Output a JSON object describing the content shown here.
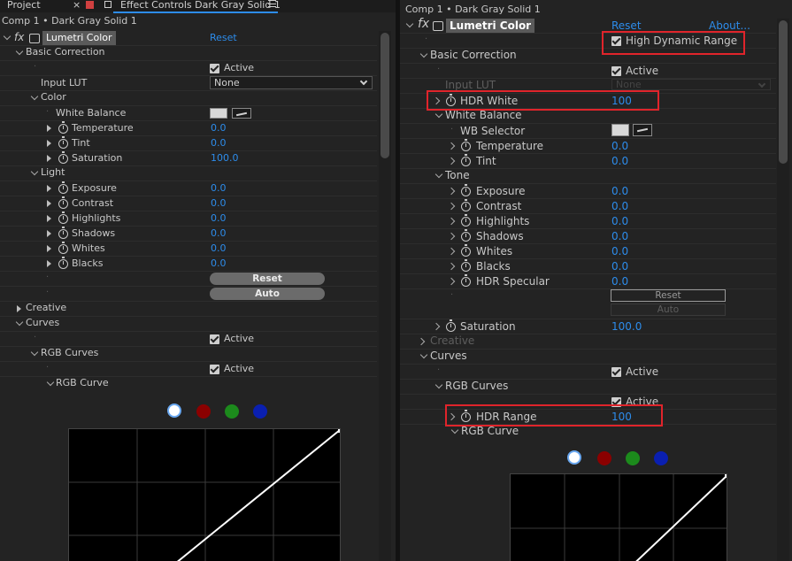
{
  "tabs": [
    {
      "label": "Project",
      "close": "×"
    },
    {
      "label": "Effect Controls Dark Gray Solid 1"
    }
  ],
  "left": {
    "breadcrumb": "Comp 1 • Dark Gray Solid 1",
    "effect_name": "Lumetri Color",
    "reset": "Reset",
    "basic_correction": "Basic Correction",
    "active": "Active",
    "input_lut": "Input LUT",
    "lut_value": "None",
    "color": "Color",
    "white_balance": "White Balance",
    "temperature": "Temperature",
    "temperature_val": "0.0",
    "tint": "Tint",
    "tint_val": "0.0",
    "saturation": "Saturation",
    "saturation_val": "100.0",
    "light": "Light",
    "exposure": "Exposure",
    "exposure_val": "0.0",
    "contrast": "Contrast",
    "contrast_val": "0.0",
    "highlights": "Highlights",
    "highlights_val": "0.0",
    "shadows": "Shadows",
    "shadows_val": "0.0",
    "whites": "Whites",
    "whites_val": "0.0",
    "blacks": "Blacks",
    "blacks_val": "0.0",
    "reset_btn": "Reset",
    "auto_btn": "Auto",
    "creative": "Creative",
    "curves": "Curves",
    "rgb_curves": "RGB Curves",
    "rgb_curve": "RGB Curve"
  },
  "right": {
    "breadcrumb": "Comp 1 • Dark Gray Solid 1",
    "effect_name": "Lumetri Color",
    "reset": "Reset",
    "about": "About...",
    "hdr": "High Dynamic Range",
    "basic_correction": "Basic Correction",
    "active": "Active",
    "input_lut": "Input LUT",
    "lut_value": "None",
    "hdr_white": "HDR White",
    "hdr_white_val": "100",
    "white_balance": "White Balance",
    "wb_selector": "WB Selector",
    "temperature": "Temperature",
    "temperature_val": "0.0",
    "tint": "Tint",
    "tint_val": "0.0",
    "tone": "Tone",
    "exposure": "Exposure",
    "exposure_val": "0.0",
    "contrast": "Contrast",
    "contrast_val": "0.0",
    "highlights": "Highlights",
    "highlights_val": "0.0",
    "shadows": "Shadows",
    "shadows_val": "0.0",
    "whites": "Whites",
    "whites_val": "0.0",
    "blacks": "Blacks",
    "blacks_val": "0.0",
    "hdr_specular": "HDR Specular",
    "hdr_specular_val": "0.0",
    "reset_btn": "Reset",
    "auto_btn": "Auto",
    "saturation": "Saturation",
    "saturation_val": "100.0",
    "creative": "Creative",
    "curves": "Curves",
    "rgb_curves": "RGB Curves",
    "hdr_range": "HDR Range",
    "hdr_range_val": "100",
    "rgb_curve": "RGB Curve"
  },
  "colors": {
    "value_blue": "#2d8ceb",
    "highlight_red": "#e0242b",
    "channel_red": "#8b0000",
    "channel_green": "#1c8a1c",
    "channel_blue": "#0a1fb0"
  },
  "icons": [
    "fx-icon",
    "stopwatch-icon",
    "checkbox-icon",
    "eyedropper-icon",
    "chevron-down-icon",
    "chevron-right-icon",
    "disclosure-triangle-icon",
    "panel-menu-icon",
    "lock-icon"
  ]
}
